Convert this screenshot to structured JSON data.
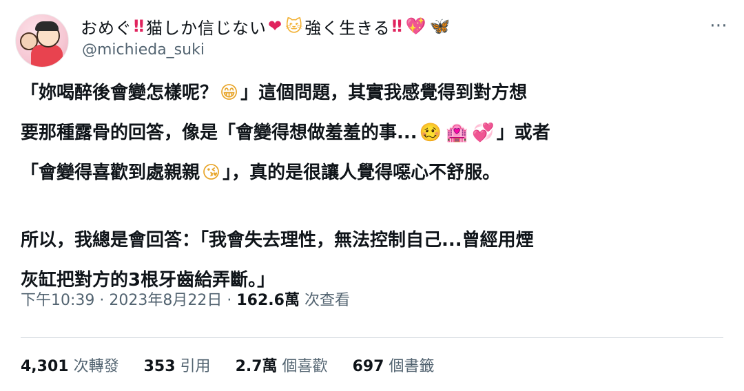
{
  "author": {
    "display_name_parts": [
      "おめぐ",
      "‼",
      "猫しか信じない",
      "❤",
      "🐱",
      "強く生きる",
      "‼",
      "💖",
      "🦋"
    ],
    "handle": "@michieda_suki"
  },
  "tweet": {
    "line1": "「妳喝醉後會變怎樣呢？",
    "line1b": "」這個問題，其實我感覺得到對方想",
    "line2": "要那種露骨的回答，像是「會變得想做羞羞的事...",
    "line2b": "」或者",
    "line3": "「會變得喜歡到處親親",
    "line3b": "」，真的是很讓人覺得噁心不舒服。",
    "line4": "所以，我總是會回答：「我會失去理性，無法控制自己...曾經用煙",
    "line5": "灰缸把對方的3根牙齒給弄斷。」",
    "emoji_grin": "😁",
    "emoji_woozy": "🥴",
    "emoji_hotel": "🏩",
    "emoji_hearts": "💞",
    "emoji_kiss": "😘"
  },
  "meta": {
    "time": "下午10:39",
    "sep1": " · ",
    "date": "2023年8月22日",
    "sep2": " · ",
    "views_count": "162.6萬",
    "views_label": " 次查看"
  },
  "stats": {
    "retweets_count": "4,301",
    "retweets_label": "次轉發",
    "quotes_count": "353",
    "quotes_label": "引用",
    "likes_count": "2.7萬",
    "likes_label": "個喜歡",
    "bookmarks_count": "697",
    "bookmarks_label": "個書籤"
  },
  "more_icon": "⋯",
  "colors": {
    "text": "#0f1419",
    "secondary": "#536471",
    "accent_red": "#e0245e"
  }
}
